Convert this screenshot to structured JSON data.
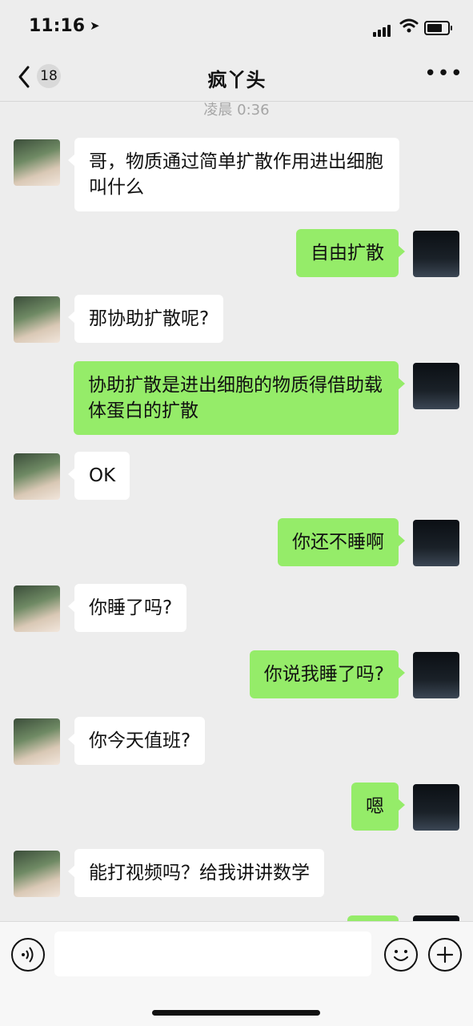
{
  "status_bar": {
    "time": "11:16"
  },
  "nav": {
    "unread_count": "18",
    "title": "疯丫头"
  },
  "timestamp": "凌晨 0:36",
  "messages": [
    {
      "side": "left",
      "text": "哥，物质通过简单扩散作用进出细胞叫什么"
    },
    {
      "side": "right",
      "text": "自由扩散"
    },
    {
      "side": "left",
      "text": "那协助扩散呢?"
    },
    {
      "side": "right",
      "text": "协助扩散是进出细胞的物质得借助载体蛋白的扩散"
    },
    {
      "side": "left",
      "text": "OK"
    },
    {
      "side": "right",
      "text": "你还不睡啊"
    },
    {
      "side": "left",
      "text": "你睡了吗?"
    },
    {
      "side": "right",
      "text": "你说我睡了吗?"
    },
    {
      "side": "left",
      "text": "你今天值班?"
    },
    {
      "side": "right",
      "text": "嗯"
    },
    {
      "side": "left",
      "text": "能打视频吗？给我讲讲数学"
    }
  ],
  "icons": {
    "back": "chevron-left-icon",
    "more": "more-icon",
    "voice": "voice-icon",
    "emoji": "emoji-icon",
    "plus": "plus-icon"
  },
  "colors": {
    "sent_bubble": "#95ec69",
    "received_bubble": "#ffffff",
    "background": "#ededed"
  }
}
